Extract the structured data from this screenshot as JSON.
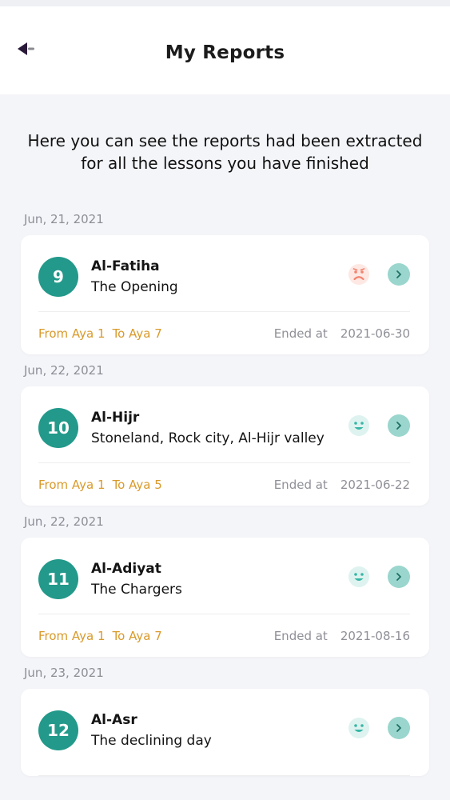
{
  "header": {
    "title": "My Reports"
  },
  "intro": "Here you can see the reports had been extracted for all the lessons you have finished",
  "labels": {
    "ended_at": "Ended at"
  },
  "colors": {
    "accent": "#22998a",
    "aya": "#d99a2b",
    "sad": "#f2836f",
    "happy": "#38b6a6"
  },
  "reports": [
    {
      "date": "Jun, 21, 2021",
      "number": "9",
      "name": "Al-Fatiha",
      "meaning": "The Opening",
      "from": "From Aya 1",
      "to": "To Aya 7",
      "ended": "2021-06-30",
      "mood": "sad-face-icon"
    },
    {
      "date": "Jun, 22, 2021",
      "number": "10",
      "name": "Al-Hijr",
      "meaning": "Stoneland, Rock city, Al-Hijr valley",
      "from": "From Aya 1",
      "to": "To Aya 5",
      "ended": "2021-06-22",
      "mood": "happy-face-icon"
    },
    {
      "date": "Jun, 22, 2021",
      "number": "11",
      "name": "Al-Adiyat",
      "meaning": "The Chargers",
      "from": "From Aya 1",
      "to": "To Aya 7",
      "ended": "2021-08-16",
      "mood": "happy-face-icon"
    },
    {
      "date": "Jun, 23, 2021",
      "number": "12",
      "name": "Al-Asr",
      "meaning": "The declining day",
      "from": "",
      "to": "",
      "ended": "",
      "mood": "happy-face-icon"
    }
  ]
}
